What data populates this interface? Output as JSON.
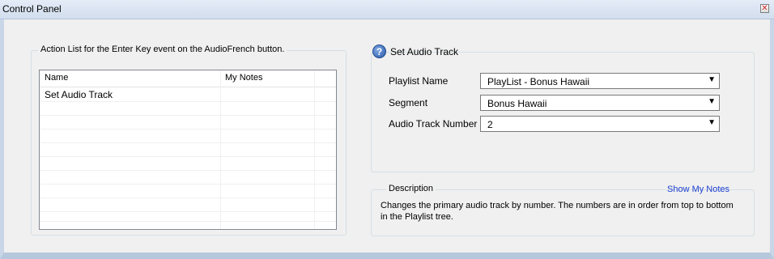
{
  "window": {
    "title": "Control Panel",
    "close_symbol": "✕"
  },
  "action_list": {
    "legend": "Action List for the Enter Key event on the AudioFrench button.",
    "columns": [
      "Name",
      "My Notes"
    ],
    "rows": [
      {
        "name": "Set Audio Track",
        "notes": ""
      }
    ]
  },
  "set_audio_track": {
    "icon": "help-icon",
    "title": "Set Audio Track",
    "fields": [
      {
        "label": "Playlist Name",
        "value": "PlayList - Bonus Hawaii"
      },
      {
        "label": "Segment",
        "value": "Bonus Hawaii"
      },
      {
        "label": "Audio Track Number",
        "value": "2"
      }
    ]
  },
  "description": {
    "legend": "Description",
    "show_notes_link": "Show My Notes",
    "text": "Changes the primary audio track by number.  The numbers are in order from top to bottom in the Playlist tree."
  },
  "colors": {
    "title_bar": "#d2deee",
    "link": "#1a3fd0"
  }
}
